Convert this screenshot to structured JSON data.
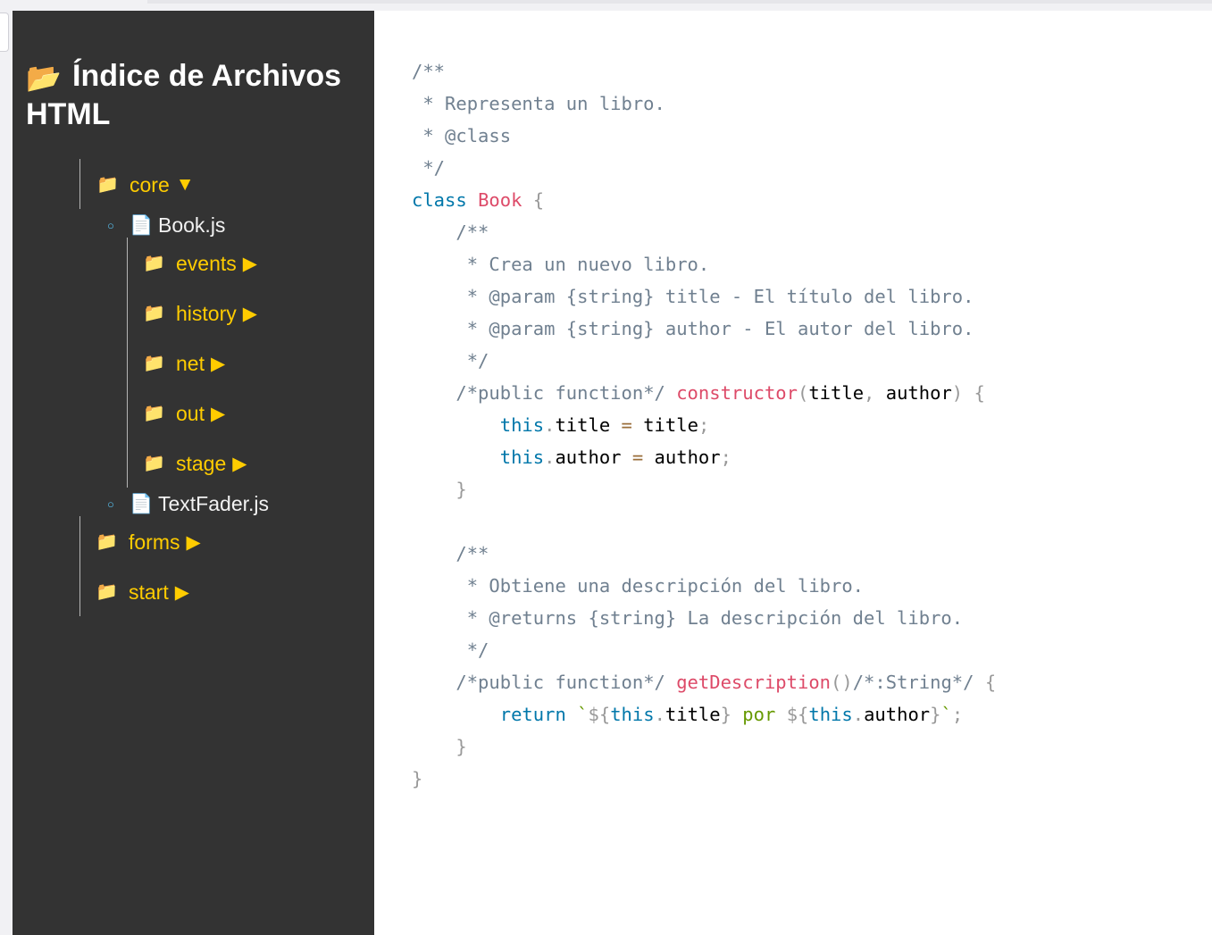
{
  "sidebar": {
    "title_icon": "open-folder-icon",
    "title": "Índice de Archivos HTML",
    "tree": {
      "core": {
        "label": "core",
        "state": "expanded",
        "arrow": "▼"
      },
      "book_js": {
        "label": "Book.js"
      },
      "events": {
        "label": "events",
        "state": "collapsed",
        "arrow": "▶"
      },
      "history": {
        "label": "history",
        "state": "collapsed",
        "arrow": "▶"
      },
      "net": {
        "label": "net",
        "state": "collapsed",
        "arrow": "▶"
      },
      "out": {
        "label": "out",
        "state": "collapsed",
        "arrow": "▶"
      },
      "stage": {
        "label": "stage",
        "state": "collapsed",
        "arrow": "▶"
      },
      "textfader_js": {
        "label": "TextFader.js"
      },
      "forms": {
        "label": "forms",
        "state": "collapsed",
        "arrow": "▶"
      },
      "start": {
        "label": "start",
        "state": "collapsed",
        "arrow": "▶"
      }
    }
  },
  "code": {
    "language": "javascript",
    "lines": [
      "/**",
      " * Representa un libro.",
      " * @class",
      " */",
      "class Book {",
      "    /**",
      "     * Crea un nuevo libro.",
      "     * @param {string} title - El título del libro.",
      "     * @param {string} author - El autor del libro.",
      "     */",
      "    /*public function*/ constructor(title, author) {",
      "        this.title = title;",
      "        this.author = author;",
      "    }",
      "",
      "    /**",
      "     * Obtiene una descripción del libro.",
      "     * @returns {string} La descripción del libro.",
      "     */",
      "    /*public function*/ getDescription()/*:String*/ {",
      "        return `${this.title} por ${this.author}`;",
      "    }",
      "}"
    ]
  },
  "colors": {
    "sidebar_bg": "#333333",
    "folder_label": "#ffcc00",
    "file_label": "#f2f2f2",
    "code_comment": "#708090",
    "code_keyword": "#0077aa",
    "code_function": "#dd4a68",
    "code_string": "#669900",
    "code_punctuation": "#999999",
    "code_operator": "#9a6e3a"
  }
}
